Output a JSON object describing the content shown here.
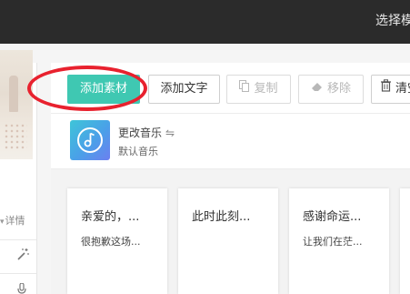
{
  "header": {
    "title": "选择模板"
  },
  "left": {
    "detail_label": "详情"
  },
  "toolbar": {
    "add_material": "添加素材",
    "add_text": "添加文字",
    "copy": "复制",
    "remove": "移除",
    "clear": "清空"
  },
  "music": {
    "title": "更改音乐",
    "swap_symbol": "⇋",
    "subtitle": "默认音乐"
  },
  "cards": [
    {
      "title": "亲爱的，...",
      "subtitle": "很抱歉这场..."
    },
    {
      "title": "此时此刻...",
      "subtitle": ""
    },
    {
      "title": "感谢命运...",
      "subtitle": "让我们在茫..."
    }
  ],
  "colors": {
    "accent": "#3fc8b2",
    "annotation": "#e8212e",
    "topbar": "#2b2b2b"
  }
}
